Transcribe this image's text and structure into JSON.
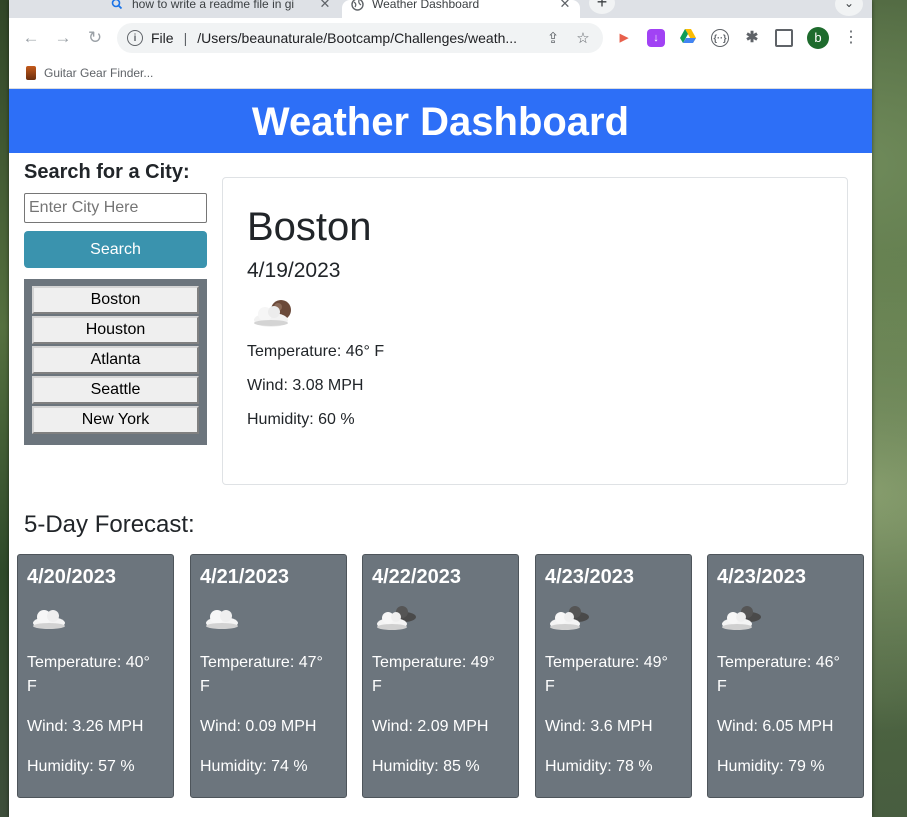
{
  "browser": {
    "tabs": [
      {
        "title": "how to write a readme file in gi",
        "icon": "google-search-icon",
        "active": false
      },
      {
        "title": "Weather Dashboard",
        "icon": "globe-icon",
        "active": true
      }
    ],
    "url_scheme": "File",
    "url": "/Users/beaunaturale/Bootcamp/Challenges/weath...",
    "bookmarks": [
      {
        "label": "Guitar Gear Finder..."
      }
    ],
    "profile_initial": "b"
  },
  "page": {
    "header_title": "Weather Dashboard",
    "search": {
      "title": "Search for a City:",
      "placeholder": "Enter City Here",
      "button_label": "Search"
    },
    "history": [
      "Boston",
      "Houston",
      "Atlanta",
      "Seattle",
      "New York"
    ],
    "current": {
      "city": "Boston",
      "date": "4/19/2023",
      "icon": "partly-cloudy-night-icon",
      "temperature": "Temperature: 46° F",
      "wind": "Wind: 3.08 MPH",
      "humidity": "Humidity: 60 %"
    },
    "forecast_title": "5-Day Forecast:",
    "forecast": [
      {
        "date": "4/20/2023",
        "icon": "cloud-icon",
        "temp": "Temperature: 40° F",
        "wind": "Wind: 3.26 MPH",
        "humidity": "Humidity: 57 %"
      },
      {
        "date": "4/21/2023",
        "icon": "cloud-icon",
        "temp": "Temperature: 47° F",
        "wind": "Wind: 0.09 MPH",
        "humidity": "Humidity: 74 %"
      },
      {
        "date": "4/22/2023",
        "icon": "broken-clouds-icon",
        "temp": "Temperature: 49° F",
        "wind": "Wind: 2.09 MPH",
        "humidity": "Humidity: 85 %"
      },
      {
        "date": "4/23/2023",
        "icon": "broken-clouds-icon",
        "temp": "Temperature: 49° F",
        "wind": "Wind: 3.6 MPH",
        "humidity": "Humidity: 78 %"
      },
      {
        "date": "4/23/2023",
        "icon": "broken-clouds-icon",
        "temp": "Temperature: 46° F",
        "wind": "Wind: 6.05 MPH",
        "humidity": "Humidity: 79 %"
      }
    ],
    "colors": {
      "header": "#2d6ff7",
      "search_button": "#3a93ae",
      "card": "#6c757d"
    }
  }
}
